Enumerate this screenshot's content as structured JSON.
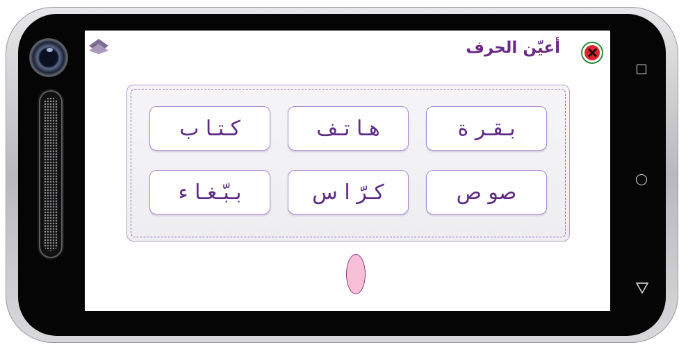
{
  "header": {
    "title": "أعيّن الحرف",
    "close_icon": "close-icon",
    "up_icon": "up-chevron-icon"
  },
  "words": [
    {
      "label": "كـتـا ب",
      "row": 1,
      "col": 1
    },
    {
      "label": "هـا تـف",
      "row": 1,
      "col": 2
    },
    {
      "label": "بـقـر ة",
      "row": 1,
      "col": 3
    },
    {
      "label": "بـبّـغـا ء",
      "row": 2,
      "col": 1
    },
    {
      "label": "كـرّ ا س",
      "row": 2,
      "col": 2
    },
    {
      "label": "صو ص",
      "row": 2,
      "col": 3
    }
  ],
  "nav": {
    "recent_icon": "square-icon",
    "home_icon": "circle-icon",
    "back_icon": "triangle-back-icon"
  },
  "colors": {
    "title": "#6b2a86",
    "word": "#5d2a84",
    "highlight": "#f7b8d3",
    "close": "#e5222a"
  }
}
